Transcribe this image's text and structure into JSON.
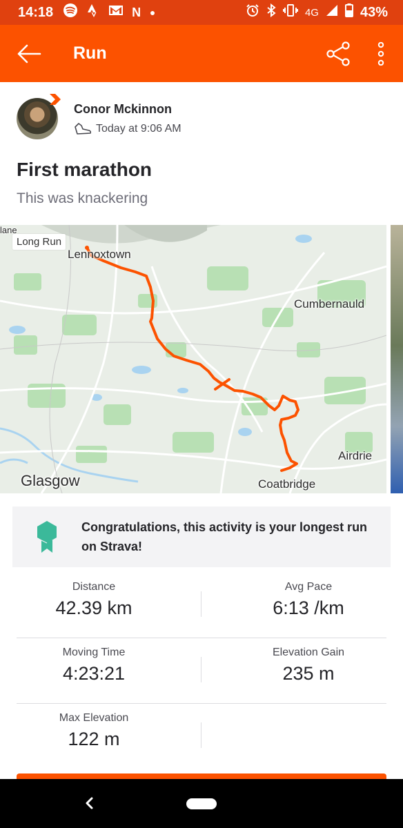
{
  "status_bar": {
    "time": "14:18",
    "left_icons": [
      "spotify-icon",
      "strava-icon",
      "gmail-icon",
      "netflix-icon",
      "dot-icon"
    ],
    "right_icons": [
      "alarm-icon",
      "bluetooth-icon",
      "vibrate-icon",
      "network-icon",
      "signal-icon",
      "battery-icon"
    ],
    "network": "4G",
    "battery": "43%",
    "netflix_glyph": "N"
  },
  "app_bar": {
    "title": "Run",
    "background": "#fc5200"
  },
  "athlete": {
    "name": "Conor Mckinnon",
    "time": "Today at 9:06 AM",
    "activity_icon": "shoe-icon"
  },
  "activity": {
    "title": "First marathon",
    "description": "This was knackering"
  },
  "map": {
    "tag": "Long Run",
    "places": {
      "lennoxtown": "Lennoxtown",
      "cumbernauld": "Cumbernauld",
      "airdrie": "Airdrie",
      "glasgow": "Glasgow",
      "coatbridge": "Coatbridge",
      "corner": "lane"
    },
    "route_color": "#fc5200"
  },
  "achievement": {
    "icon": "medal-icon",
    "message": "Congratulations, this activity is your longest run on Strava!",
    "color": "#3bb99a"
  },
  "stats": {
    "distance": {
      "label": "Distance",
      "value": "42.39 km"
    },
    "avg_pace": {
      "label": "Avg Pace",
      "value": "6:13 /km"
    },
    "moving_time": {
      "label": "Moving Time",
      "value": "4:23:21"
    },
    "elevation_gain": {
      "label": "Elevation Gain",
      "value": "235 m"
    },
    "max_elevation": {
      "label": "Max Elevation",
      "value": "122 m"
    }
  }
}
